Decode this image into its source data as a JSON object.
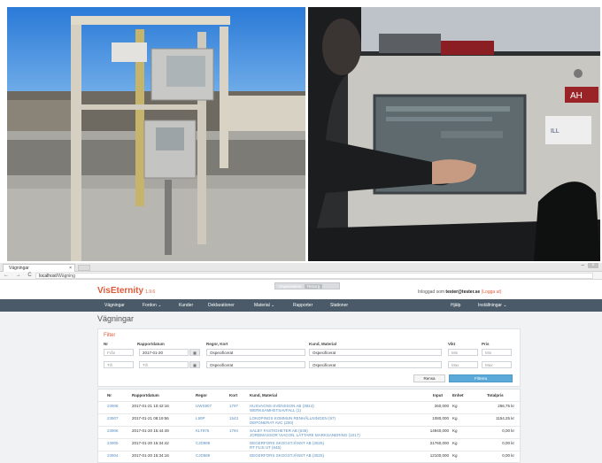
{
  "browser": {
    "tab_title": "Vägningar",
    "tab_close": "×",
    "url_host": "localhost",
    "url_path": "/Wägning",
    "nav_buttons": "← → C ⌂"
  },
  "app": {
    "logo": "VisEternity",
    "version": "1.9.6",
    "center_label": "Organisation",
    "center_tag": "Testorg",
    "login_prefix": "Inloggad som",
    "login_user": "tester@tester.se",
    "logout": "(Logga ut)"
  },
  "nav": {
    "items": [
      "Vägningar",
      "Fordon ⌄",
      "Kunder",
      "Deklarationer",
      "Material ⌄",
      "Rapporter",
      "Stationer"
    ],
    "right_items": [
      "Hjälp",
      "Inställningar ⌄"
    ]
  },
  "page": {
    "title": "Vägningar"
  },
  "filter": {
    "title": "Filter",
    "labels": {
      "nr": "Nr",
      "date": "Rapportdatum",
      "regnr": "Regnr, Kort",
      "customer": "Kund, Material",
      "weight": "Vikt",
      "price": "Pris"
    },
    "nr_from": "Från",
    "nr_to": "Till",
    "date_from": "2017-01-20",
    "date_to": "Till",
    "calendar_icon": "▦",
    "regnr_select": "Ospecificerat",
    "card_select": "Ospecificerat",
    "customer_select": "Ospecificerat",
    "material_select": "Ospecificerat",
    "weight_min": "Min",
    "weight_max": "Max",
    "price_min": "Min",
    "price_max": "Max",
    "reset": "Rensa",
    "submit": "Filtrera"
  },
  "table": {
    "headers": [
      "Nr",
      "Rapportdatum",
      "Regnr",
      "Kort",
      "Kund, Material",
      "Input",
      "Enhet",
      "Totalpris"
    ],
    "rows": [
      {
        "nr": "23908",
        "date": "2017-01-21 10:42:16",
        "regnr": "UWS907",
        "kort": "1797",
        "customer": "HUSVAGNS-SVENSSON AB (3924)",
        "material": "WERKSAMHETSAVFALL (1)",
        "input": "260,000",
        "unit": "Kg",
        "price": "256,75 kr"
      },
      {
        "nr": "23907",
        "date": "2017-01-21 08:19:56",
        "regnr": "L90P",
        "kort": "1543",
        "customer": "LOKOPINGS KOMMUN RENHÅLLNINGEN (97)",
        "material": "DEPONERAT AVC (200)",
        "input": "1080,000",
        "unit": "Kg",
        "price": "1154,25 kr"
      },
      {
        "nr": "23906",
        "date": "2017-01-20 15:44:49",
        "regnr": "KLT976",
        "kort": "1794",
        "customer": "SALBY FASTIGHETER AB (636)",
        "material": "JORDMASSOR VIACON, LÄTTARE MARKSANERING (1017)",
        "input": "14940,000",
        "unit": "Kg",
        "price": "0,00 kr"
      },
      {
        "nr": "23905",
        "date": "2017-01-20 15:34:42",
        "regnr": "CJD989",
        "kort": "",
        "customer": "DEGERFORS SKOGSTJÄNST AB (3025)",
        "material": "RT FLIS UT (645)",
        "input": "21760,000",
        "unit": "Kg",
        "price": "0,00 kr"
      },
      {
        "nr": "23904",
        "date": "2017-01-20 15:34:16",
        "regnr": "CJD989",
        "kort": "",
        "customer": "DEGERFORS SKOGSTJÄNST AB (3025)",
        "material": "",
        "input": "12100,000",
        "unit": "Kg",
        "price": "0,00 kr"
      }
    ]
  },
  "photo_right": {
    "brand": "AH",
    "badge": "ILL"
  }
}
